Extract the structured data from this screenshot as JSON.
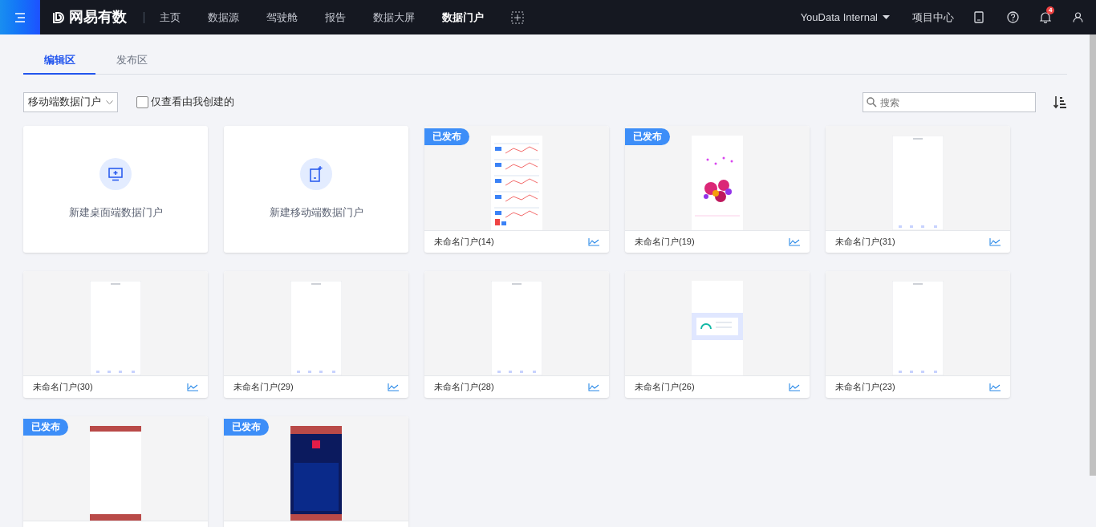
{
  "nav": {
    "logo": "网易有数",
    "items": [
      {
        "label": "主页",
        "selected": false
      },
      {
        "label": "数据源",
        "selected": false
      },
      {
        "label": "驾驶舱",
        "selected": false
      },
      {
        "label": "报告",
        "selected": false
      },
      {
        "label": "数据大屏",
        "selected": false
      },
      {
        "label": "数据门户",
        "selected": true
      }
    ],
    "workspace": "YouData Internal",
    "project_center": "项目中心",
    "notifications": "4"
  },
  "tabs": [
    {
      "label": "编辑区",
      "selected": true
    },
    {
      "label": "发布区",
      "selected": false
    }
  ],
  "filter": {
    "type_select": "移动端数据门户",
    "only_mine": {
      "label": "仅查看由我创建的",
      "checked": false
    }
  },
  "search": {
    "placeholder": "搜索"
  },
  "create_cards": [
    {
      "kind": "desktop",
      "label": "新建桌面端数据门户"
    },
    {
      "kind": "mobile",
      "label": "新建移动端数据门户"
    }
  ],
  "portals": [
    {
      "badge": "已发布",
      "title": "未命名门户(14)",
      "kind": "dashboard"
    },
    {
      "badge": "已发布",
      "title": "未命名门户(19)",
      "kind": "bubbles"
    },
    {
      "title": "未命名门户(31)",
      "kind": "blank"
    },
    {
      "title": "未命名门户(30)",
      "kind": "blank"
    },
    {
      "title": "未命名门户(29)",
      "kind": "blank"
    },
    {
      "title": "未命名门户(28)",
      "kind": "blank"
    },
    {
      "title": "未命名门户(26)",
      "kind": "gauge"
    },
    {
      "title": "未命名门户(23)",
      "kind": "blank"
    },
    {
      "badge": "已发布",
      "kind": "banded"
    },
    {
      "badge": "已发布",
      "kind": "dark"
    }
  ]
}
